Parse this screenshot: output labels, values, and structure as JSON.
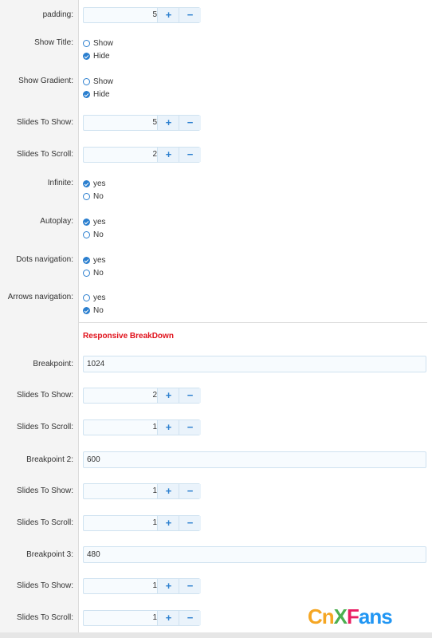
{
  "fields": [
    {
      "label": "padding:",
      "value": "5"
    },
    {
      "label": "Show Title:",
      "options": [
        "Show",
        "Hide"
      ],
      "selected": "Hide"
    },
    {
      "label": "Show Gradient:",
      "options": [
        "Show",
        "Hide"
      ],
      "selected": "Hide"
    },
    {
      "label": "Slides To Show:",
      "value": "5"
    },
    {
      "label": "Slides To Scroll:",
      "value": "2"
    },
    {
      "label": "Infinite:",
      "options": [
        "yes",
        "No"
      ],
      "selected": "yes"
    },
    {
      "label": "Autoplay:",
      "options": [
        "yes",
        "No"
      ],
      "selected": "yes"
    },
    {
      "label": "Dots navigation:",
      "options": [
        "yes",
        "No"
      ],
      "selected": "yes"
    },
    {
      "label": "Arrows navigation:",
      "options": [
        "yes",
        "No"
      ],
      "selected": "No"
    }
  ],
  "section_title": "Responsive BreakDown",
  "breakpoints": [
    {
      "label": "Breakpoint:",
      "value": "1024",
      "show_label": "Slides To Show:",
      "show_value": "2",
      "scroll_label": "Slides To Scroll:",
      "scroll_value": "1"
    },
    {
      "label": "Breakpoint 2:",
      "value": "600",
      "show_label": "Slides To Show:",
      "show_value": "1",
      "scroll_label": "Slides To Scroll:",
      "scroll_value": "1"
    },
    {
      "label": "Breakpoint 3:",
      "value": "480",
      "show_label": "Slides To Show:",
      "show_value": "1",
      "scroll_label": "Slides To Scroll:",
      "scroll_value": "1"
    }
  ],
  "stepper_buttons": {
    "plus": "+",
    "minus": "−"
  },
  "watermark": {
    "letters": [
      "C",
      "n",
      "X",
      "F",
      "a",
      "n",
      "s"
    ],
    "colors": [
      "#f5a623",
      "#f5a623",
      "#4caf50",
      "#e91e63",
      "#2196f3",
      "#2196f3",
      "#2196f3"
    ]
  }
}
